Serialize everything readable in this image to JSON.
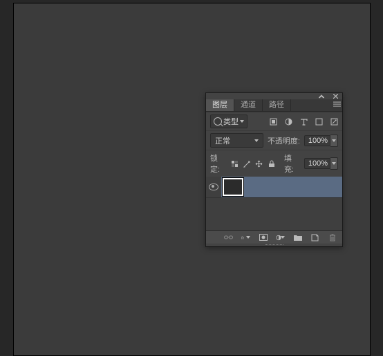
{
  "tabs": [
    "图层",
    "通道",
    "路径"
  ],
  "filter": {
    "kind": "类型"
  },
  "blend": {
    "mode": "正常",
    "opacity_label": "不透明度:",
    "opacity_value": "100%"
  },
  "lock": {
    "label": "锁定:",
    "fill_label": "填充:",
    "fill_value": "100%"
  },
  "layers": [
    {
      "name": "",
      "visible": true,
      "selected": true
    }
  ],
  "colors": {
    "panel_bg": "#434343",
    "selected_layer": "#5a6b83",
    "canvas_bg": "#3b3b3b",
    "app_bg": "#272727"
  }
}
